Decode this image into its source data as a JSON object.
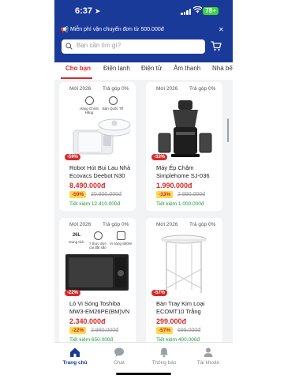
{
  "status_bar": {
    "time": "6:37",
    "battery": "78+"
  },
  "promo": {
    "text": "Miễn phí vận chuyển đơn từ 500.000đ"
  },
  "search": {
    "placeholder": "Bạn cần tìm gì?"
  },
  "tabs": [
    {
      "label": "Cho bạn",
      "active": true
    },
    {
      "label": "Điện lạnh"
    },
    {
      "label": "Điện tử"
    },
    {
      "label": "Âm thanh"
    },
    {
      "label": "Nhà bế"
    }
  ],
  "products": [
    {
      "new_tag": "Mới 2026",
      "installment": "Trả góp 0%",
      "features": [
        "Hàng Chính Hãng",
        "Bản Quốc Tế"
      ],
      "discount_badge": "-59%",
      "name": "Robot Hút Bụi Lau Nhà Ecovacs Deebot N30 Pro...",
      "price": "8.490.000đ",
      "discount": "-59%",
      "old_price": "20.900.000đ",
      "saving": "Tiết kiệm 12.410.000đ"
    },
    {
      "new_tag": "Mới 2026",
      "installment": "Trả góp 0%",
      "discount_badge": "-33%",
      "name": "Máy Ép Chậm Simplehome SJ-036",
      "price": "1.990.000đ",
      "discount": "-33%",
      "old_price": "2.990.000đ",
      "saving": "Tiết kiệm 1.000.000đ"
    },
    {
      "new_tag": "Mới 2026",
      "installment": "Trả góp 0%",
      "features": [
        "Dung tích",
        "7 thực đơn cài đặt sẵn",
        "Vi sóng 800W"
      ],
      "feature_values": [
        "26L",
        "",
        ""
      ],
      "discount_badge": "-22%",
      "name": "Lò Vi Sóng Toshiba MW3-EM26PE(BM)VN 26 Lít -...",
      "price": "2.340.000đ",
      "discount": "-22%",
      "old_price": "2.990.000đ",
      "saving": "Tiết kiệm 650.000đ"
    },
    {
      "new_tag": "Mới 2026",
      "installment": "Trả góp 0%",
      "discount_badge": "-57%",
      "name": "Bàn Tray Kim Loại ECOMT10 Trắng",
      "price": "299.000đ",
      "discount": "-57%",
      "old_price": "699.000đ",
      "saving": "Tiết kiệm 400.000đ"
    }
  ],
  "bottom_nav": [
    {
      "label": "Trang chủ",
      "icon": "home-icon",
      "active": true
    },
    {
      "label": "Chat",
      "icon": "chat-icon"
    },
    {
      "label": "Thông báo",
      "icon": "bell-icon"
    },
    {
      "label": "Tài khoản",
      "icon": "user-icon"
    }
  ],
  "colors": {
    "header": "#1a3a9a",
    "accent_red": "#d62b2b",
    "discount_yellow": "#ffd84d",
    "saving_green": "#1c9b3a"
  }
}
